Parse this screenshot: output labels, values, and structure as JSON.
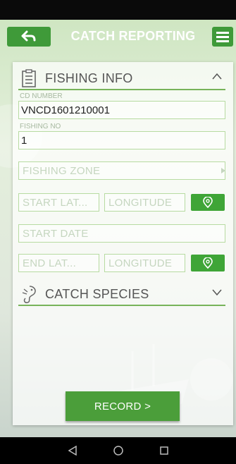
{
  "header": {
    "title": "CATCH REPORTING",
    "back_icon": "back-arrow-icon",
    "menu_icon": "hamburger-menu-icon"
  },
  "fishing_info": {
    "title": "FISHING INFO",
    "cd_number_caption": "CD NUMBER",
    "cd_number_value": "VNCD1601210001",
    "fishing_no_caption": "FISHING NO",
    "fishing_no_value": "1",
    "fishing_zone_placeholder": "FISHING ZONE",
    "start_lat_placeholder": "START LAT...",
    "start_longitude_placeholder": "LONGITUDE",
    "start_date_placeholder": "START DATE",
    "end_lat_placeholder": "END LAT...",
    "end_longitude_placeholder": "LONGITUDE"
  },
  "catch_species": {
    "title": "CATCH SPECIES"
  },
  "record_button": "RECORD >",
  "colors": {
    "accent": "#3f9a39",
    "field_border": "#b7dba1",
    "section_rule": "#77b35a"
  }
}
